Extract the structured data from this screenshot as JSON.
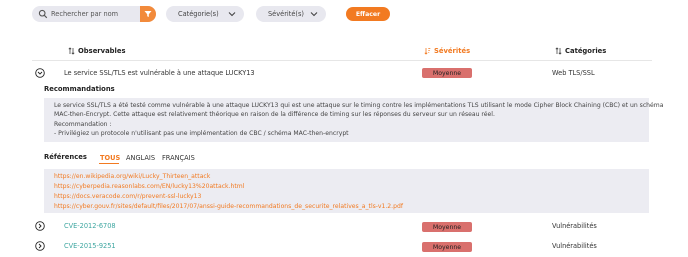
{
  "filters": {
    "search_placeholder": "Rechercher par nom",
    "category_label": "Catégorie(s)",
    "severity_label": "Sévérité(s)",
    "clear_label": "Effacer"
  },
  "colors": {
    "accent": "#f27a21",
    "badge": "#d9706d",
    "link": "#3ea6a0",
    "panel": "#ececf2"
  },
  "table": {
    "headers": {
      "observables": "Observables",
      "severities": "Sévérités",
      "categories": "Catégories"
    },
    "rows": [
      {
        "name": "Le service SSL/TLS est vulnérable à une attaque LUCKY13",
        "severity": "Moyenne",
        "category": "Web TLS/SSL",
        "expanded": true
      },
      {
        "name": "CVE-2012-6708",
        "severity": "Moyenne",
        "category": "Vulnérabilités",
        "expanded": false
      },
      {
        "name": "CVE-2015-9251",
        "severity": "Moyenne",
        "category": "Vulnérabilités",
        "expanded": false
      }
    ]
  },
  "details": {
    "recommendations_title": "Recommandations",
    "recommendations_lines": [
      "Le service SSL/TLS a été testé comme vulnérable à une attaque LUCKY13 qui est une attaque sur le timing contre les implémentations TLS utilisant le mode Cipher Block Chaining (CBC) et un schéma",
      "MAC-then-Encrypt. Cette attaque est relativement théorique en raison de la différence de timing sur les réponses du serveur sur un réseau réel.",
      "Recommandation :",
      "- Privilégiez un protocole n'utilisant pas une implémentation de CBC / schéma MAC-then-encrypt"
    ],
    "references_title": "Références",
    "reference_tabs": [
      "TOUS",
      "ANGLAIS",
      "FRANÇAIS"
    ],
    "active_tab": "TOUS",
    "references": [
      "https://en.wikipedia.org/wiki/Lucky_Thirteen_attack",
      "https://cyberpedia.reasonlabs.com/EN/lucky13%20attack.html",
      "https://docs.veracode.com/r/prevent-ssl-lucky13",
      "https://cyber.gouv.fr/sites/default/files/2017/07/anssi-guide-recommandations_de_securite_relatives_a_tls-v1.2.pdf"
    ]
  }
}
